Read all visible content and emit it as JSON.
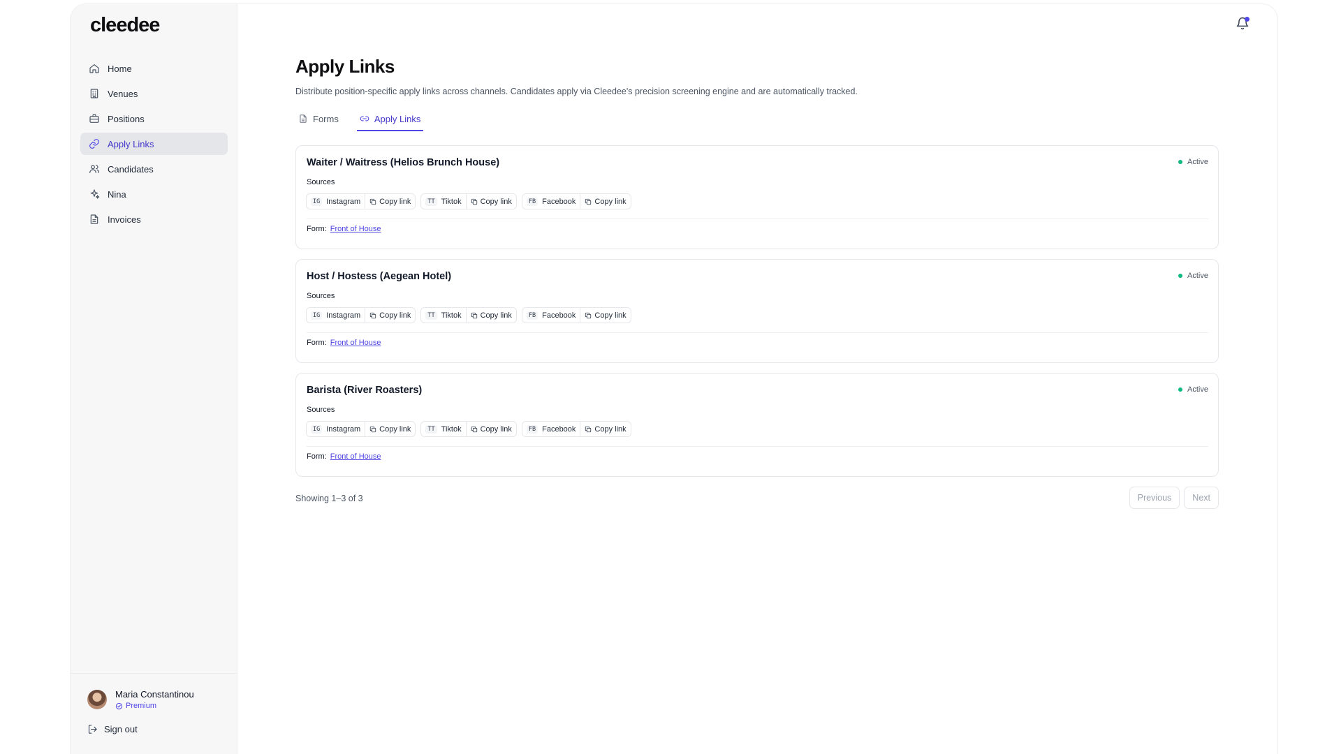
{
  "brand": "cleedee",
  "sidebar": {
    "items": [
      {
        "label": "Home",
        "icon": "home-icon"
      },
      {
        "label": "Venues",
        "icon": "building-icon"
      },
      {
        "label": "Positions",
        "icon": "briefcase-icon"
      },
      {
        "label": "Apply Links",
        "icon": "link-icon",
        "active": true
      },
      {
        "label": "Candidates",
        "icon": "users-icon"
      },
      {
        "label": "Nina",
        "icon": "sparkles-icon"
      },
      {
        "label": "Invoices",
        "icon": "document-icon"
      }
    ]
  },
  "user": {
    "name": "Maria Constantinou",
    "plan": "Premium"
  },
  "signout_label": "Sign out",
  "header": {
    "title": "Apply Links",
    "description": "Distribute position-specific apply links across channels. Candidates apply via Cleedee's precision screening engine and are automatically tracked."
  },
  "tabs": [
    {
      "label": "Forms",
      "icon": "file-icon"
    },
    {
      "label": "Apply Links",
      "icon": "link-icon",
      "active": true
    }
  ],
  "sources_label": "Sources",
  "copy_label": "Copy link",
  "form_label": "Form:",
  "cards": [
    {
      "title": "Waiter / Waitress (Helios Brunch House)",
      "status": "Active",
      "sources": [
        {
          "abbr": "IG",
          "name": "Instagram"
        },
        {
          "abbr": "TT",
          "name": "Tiktok"
        },
        {
          "abbr": "FB",
          "name": "Facebook"
        }
      ],
      "form": "Front of House"
    },
    {
      "title": "Host / Hostess (Aegean Hotel)",
      "status": "Active",
      "sources": [
        {
          "abbr": "IG",
          "name": "Instagram"
        },
        {
          "abbr": "TT",
          "name": "Tiktok"
        },
        {
          "abbr": "FB",
          "name": "Facebook"
        }
      ],
      "form": "Front of House"
    },
    {
      "title": "Barista (River Roasters)",
      "status": "Active",
      "sources": [
        {
          "abbr": "IG",
          "name": "Instagram"
        },
        {
          "abbr": "TT",
          "name": "Tiktok"
        },
        {
          "abbr": "FB",
          "name": "Facebook"
        }
      ],
      "form": "Front of House"
    }
  ],
  "pagination": {
    "showing": "Showing 1–3 of 3",
    "previous": "Previous",
    "next": "Next"
  },
  "colors": {
    "accent": "#4f46e5",
    "active_status": "#10b981"
  }
}
